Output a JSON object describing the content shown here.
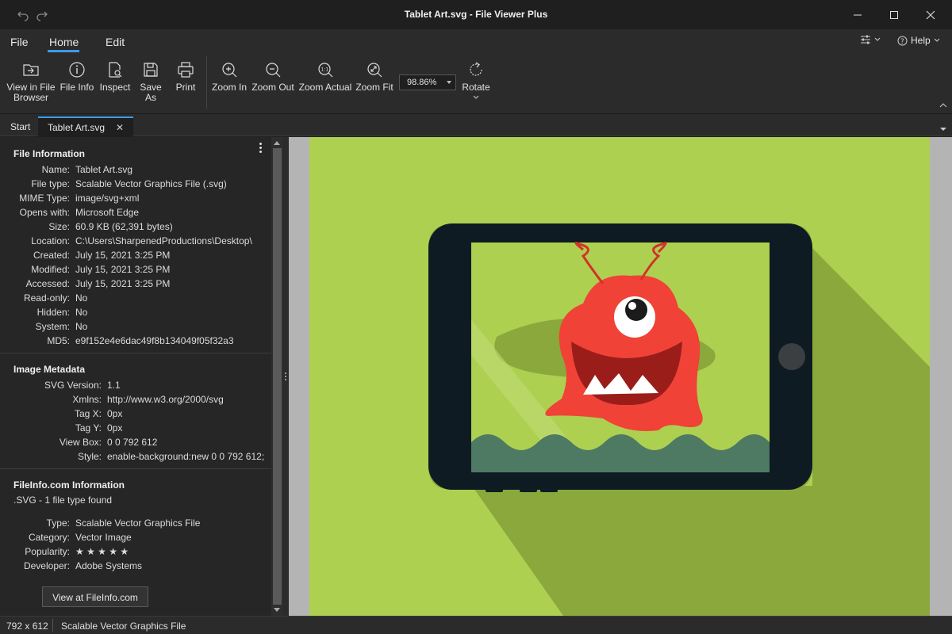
{
  "window": {
    "title": "Tablet Art.svg - File Viewer Plus"
  },
  "menu": {
    "items": [
      "File",
      "Home",
      "Edit"
    ],
    "active": "Home",
    "help_label": "Help"
  },
  "ribbon": {
    "view_in_browser_line1": "View in File",
    "view_in_browser_line2": "Browser",
    "file_info": "File Info",
    "inspect": "Inspect",
    "save_as": "Save As",
    "print": "Print",
    "zoom_in": "Zoom In",
    "zoom_out": "Zoom Out",
    "zoom_actual": "Zoom Actual",
    "zoom_fit": "Zoom Fit",
    "zoom_value": "98.86%",
    "rotate": "Rotate"
  },
  "tabs": {
    "start": "Start",
    "active_file": "Tablet Art.svg",
    "close_glyph": "✕"
  },
  "file_information": {
    "title": "File Information",
    "rows": [
      {
        "key": "Name:",
        "value": "Tablet Art.svg"
      },
      {
        "key": "File type:",
        "value": "Scalable Vector Graphics File (.svg)"
      },
      {
        "key": "MIME Type:",
        "value": "image/svg+xml"
      },
      {
        "key": "Opens with:",
        "value": "Microsoft Edge"
      },
      {
        "key": "Size:",
        "value": "60.9 KB (62,391 bytes)"
      },
      {
        "key": "Location:",
        "value": "C:\\Users\\SharpenedProductions\\Desktop\\"
      },
      {
        "key": "Created:",
        "value": "July 15, 2021 3:25 PM"
      },
      {
        "key": "Modified:",
        "value": "July 15, 2021 3:25 PM"
      },
      {
        "key": "Accessed:",
        "value": "July 15, 2021 3:25 PM"
      },
      {
        "key": "Read-only:",
        "value": "No"
      },
      {
        "key": "Hidden:",
        "value": "No"
      },
      {
        "key": "System:",
        "value": "No"
      },
      {
        "key": "MD5:",
        "value": "e9f152e4e6dac49f8b134049f05f32a3"
      }
    ]
  },
  "image_metadata": {
    "title": "Image Metadata",
    "rows": [
      {
        "key": "SVG Version:",
        "value": "1.1"
      },
      {
        "key": "Xmlns:",
        "value": "http://www.w3.org/2000/svg"
      },
      {
        "key": "Tag X:",
        "value": "0px"
      },
      {
        "key": "Tag Y:",
        "value": "0px"
      },
      {
        "key": "View Box:",
        "value": "0 0 792 612"
      },
      {
        "key": "Style:",
        "value": "enable-background:new 0 0 792 612;"
      }
    ]
  },
  "fileinfo_com": {
    "title": "FileInfo.com Information",
    "summary": ".SVG - 1 file type found",
    "rows": [
      {
        "key": "Type:",
        "value": "Scalable Vector Graphics File"
      },
      {
        "key": "Category:",
        "value": "Vector Image"
      },
      {
        "key": "Popularity:",
        "value": "★ ★ ★ ★ ★"
      },
      {
        "key": "Developer:",
        "value": "Adobe Systems"
      }
    ],
    "button": "View at FileInfo.com"
  },
  "status": {
    "dimensions": "792 x 612",
    "type": "Scalable Vector Graphics File"
  },
  "colors": {
    "accent": "#3d9be9",
    "canvas_bg": "#add050",
    "tablet_body": "#0f1b22",
    "monster": "#f04236"
  }
}
